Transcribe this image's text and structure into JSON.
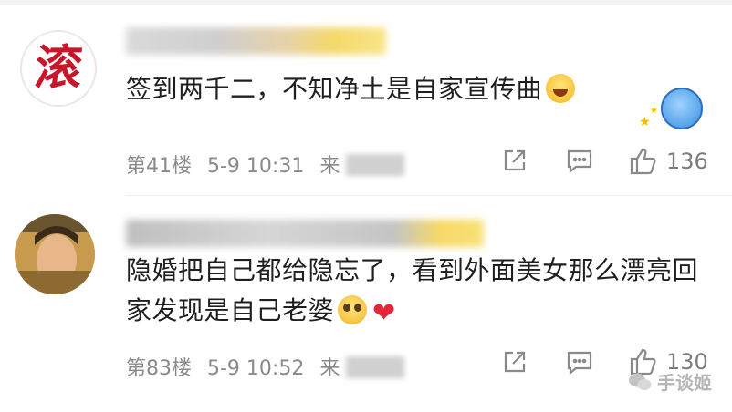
{
  "comments": [
    {
      "avatar_glyph": "滚",
      "text": "签到两千二，不知净土是自家宣传曲",
      "floor": "第41楼",
      "time": "5-9 10:31",
      "source_prefix": "来",
      "likes": "136"
    },
    {
      "text": "隐婚把自己都给隐忘了，看到外面美女那么漂亮回家发现是自己老婆",
      "floor": "第83楼",
      "time": "5-9 10:52",
      "source_prefix": "来",
      "likes": "130"
    }
  ],
  "watermark": {
    "text": "手谈姬"
  }
}
